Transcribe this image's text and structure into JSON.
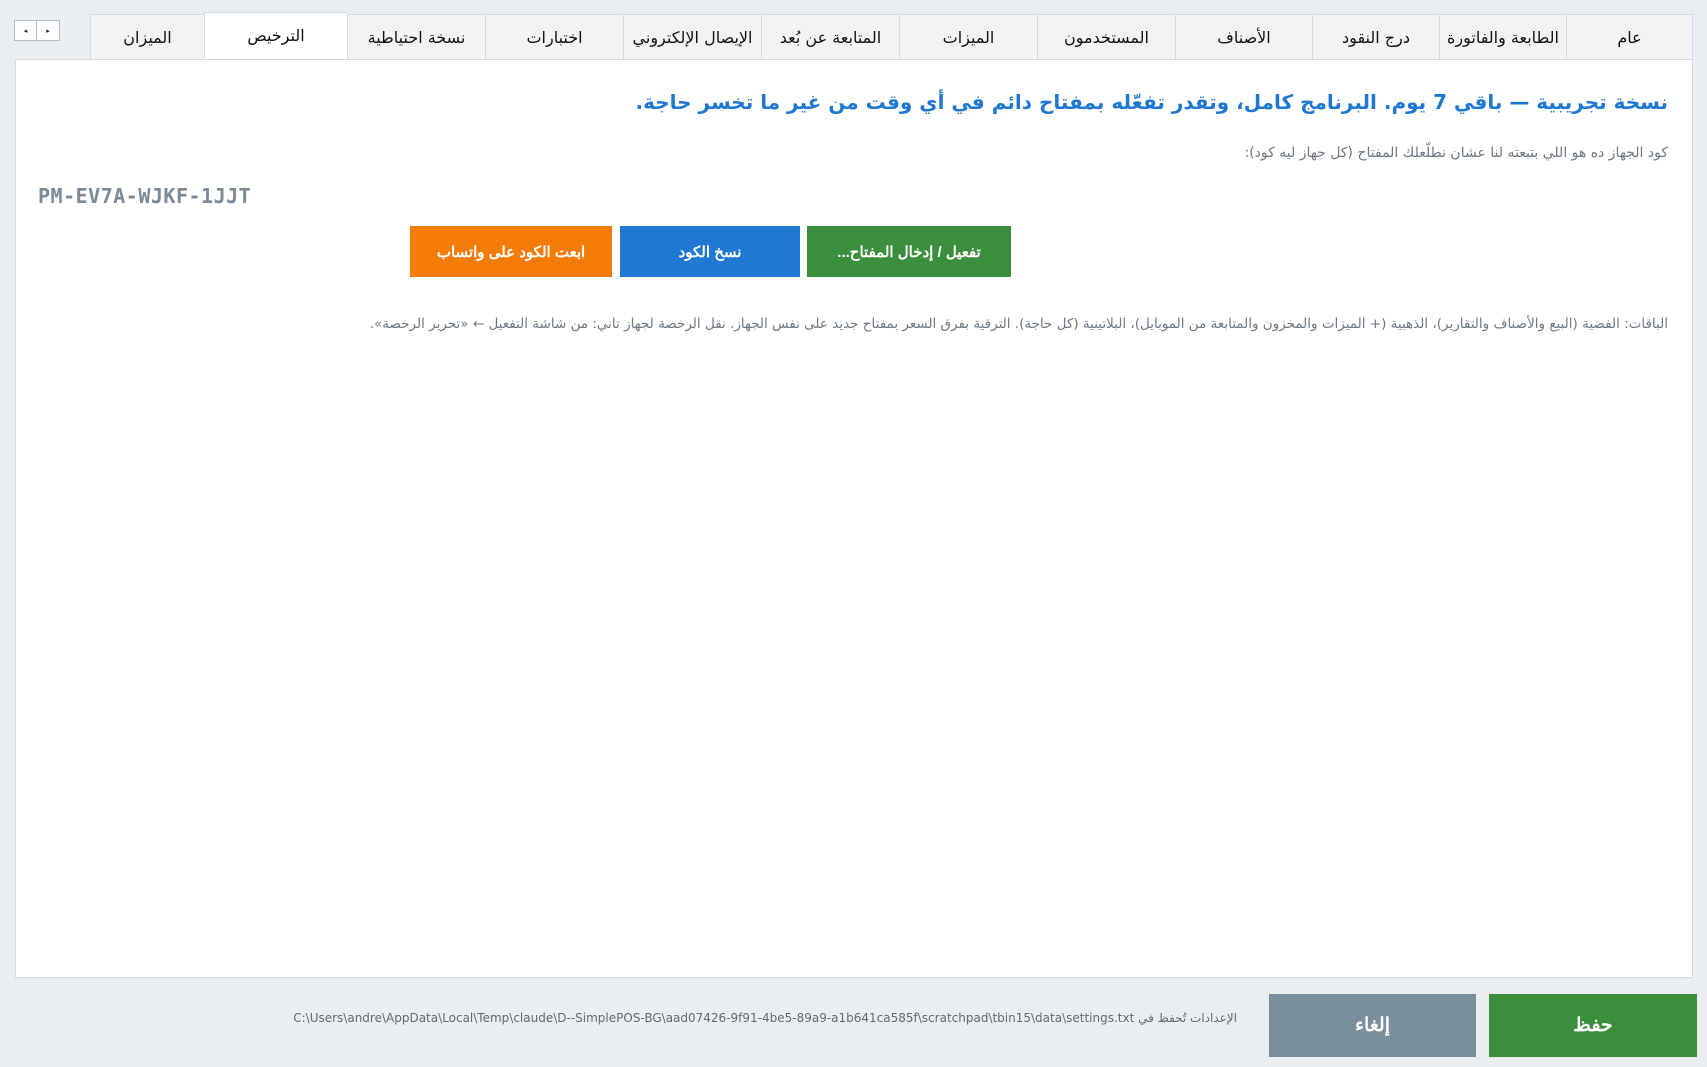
{
  "tabs": [
    {
      "label": "عام",
      "name": "tab-general",
      "active": false
    },
    {
      "label": "الطابعة والفاتورة",
      "name": "tab-printer-invoice",
      "active": false
    },
    {
      "label": "درج النقود",
      "name": "tab-cash-drawer",
      "active": false
    },
    {
      "label": "الأصناف",
      "name": "tab-items",
      "active": false
    },
    {
      "label": "المستخدمون",
      "name": "tab-users",
      "active": false
    },
    {
      "label": "الميزات",
      "name": "tab-features",
      "active": false
    },
    {
      "label": "المتابعة عن بُعد",
      "name": "tab-remote-monitoring",
      "active": false
    },
    {
      "label": "الإيصال الإلكتروني",
      "name": "tab-e-receipt",
      "active": false
    },
    {
      "label": "اختبارات",
      "name": "tab-tests",
      "active": false
    },
    {
      "label": "نسخة احتياطية",
      "name": "tab-backup",
      "active": false
    },
    {
      "label": "الترخيص",
      "name": "tab-license",
      "active": true
    },
    {
      "label": "الميزان",
      "name": "tab-scale",
      "active": false
    }
  ],
  "tab_scroll": {
    "left": "◂",
    "right": "▸"
  },
  "license": {
    "headline": "نسخة تجريبية — باقي 7 يوم. البرنامج كامل، وتقدر تفعّله بمفتاح دائم في أي وقت من غير ما تخسر حاجة.",
    "code_hint": "كود الجهاز ده هو اللي بتبعته لنا عشان نطلّعلك المفتاح (كل جهاز ليه كود):",
    "device_code": "PM-EV7A-WJKF-1JJT",
    "buttons": {
      "activate": "تفعيل / إدخال المفتاح...",
      "copy": "نسخ الكود",
      "whatsapp": "ابعت الكود على واتساب"
    },
    "packages_note": "الباقات: الفضية (البيع والأصناف والتقارير)، الذهبية (+ الميزات والمخزون والمتابعة من الموبايل)، البلاتينية (كل حاجة). الترقية بفرق السعر بمفتاح جديد على نفس الجهاز. نقل الرخصة لجهاز تاني: من شاشة التفعيل ← «تحرير الرخصة»."
  },
  "footer": {
    "settings_path": "الإعدادات تُحفظ في C:\\Users\\andre\\AppData\\Local\\Temp\\claude\\D--SimplePOS-BG\\aad07426-9f91-4be5-89a9-a1b641ca585f\\scratchpad\\tbin15\\data\\settings.txt",
    "cancel_label": "إلغاء",
    "save_label": "حفظ"
  },
  "colors": {
    "accent_blue": "#1e78d2",
    "green": "#3a8e3c",
    "orange": "#f47b06",
    "slate": "#79909c"
  }
}
